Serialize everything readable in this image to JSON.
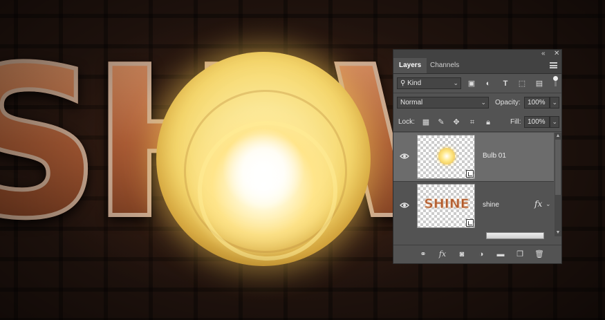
{
  "canvas": {
    "letters": [
      "S",
      "H",
      "W"
    ],
    "colors": {
      "copper": "#b8683e",
      "bulb": "#f6d86e",
      "brick": "#24150f"
    }
  },
  "panel": {
    "tabs": [
      {
        "label": "Layers",
        "active": true
      },
      {
        "label": "Channels",
        "active": false
      }
    ],
    "filter": {
      "value": "Kind",
      "icons": [
        "image-filter-icon",
        "adjustment-filter-icon",
        "type-filter-icon",
        "shape-filter-icon",
        "smart-object-filter-icon",
        "filter-toggle-icon"
      ]
    },
    "blend_mode": "Normal",
    "opacity": {
      "label": "Opacity:",
      "value": "100%"
    },
    "lock": {
      "label": "Lock:",
      "icons": [
        "lock-transparent-icon",
        "lock-image-icon",
        "lock-position-icon",
        "lock-artboard-icon",
        "lock-all-icon"
      ]
    },
    "fill": {
      "label": "Fill:",
      "value": "100%"
    },
    "layers": [
      {
        "name": "Bulb 01",
        "visible": true,
        "selected": true,
        "effects": false
      },
      {
        "name": "shine",
        "visible": true,
        "selected": false,
        "effects": true,
        "thumb_text": "SHINE"
      }
    ],
    "fx_label": "fx",
    "footer_icons": [
      "link-layers-icon",
      "add-style-icon",
      "add-mask-icon",
      "adjustment-layer-icon",
      "group-icon",
      "new-layer-icon",
      "trash-icon"
    ],
    "accent": "#6c6c6c"
  }
}
